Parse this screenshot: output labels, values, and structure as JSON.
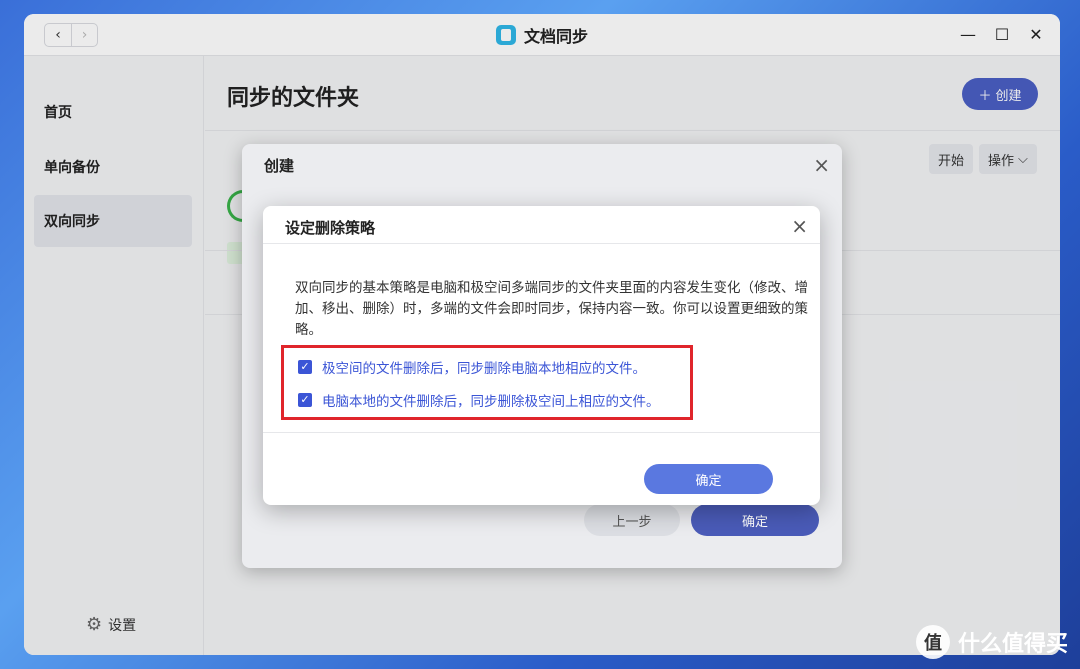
{
  "window": {
    "title": "文档同步",
    "nav_back": "‹",
    "nav_forward": "›",
    "ctrl_min": "—",
    "ctrl_max": "☐",
    "ctrl_close": "✕"
  },
  "sidebar": {
    "items": [
      {
        "label": "首页"
      },
      {
        "label": "单向备份"
      },
      {
        "label": "双向同步"
      }
    ],
    "settings_label": "设置"
  },
  "main": {
    "page_title": "同步的文件夹",
    "create_label": "创建",
    "start_label": "开始",
    "actions_label": "操作"
  },
  "create_dialog": {
    "title": "创建",
    "prev_label": "上一步",
    "ok_label": "确定"
  },
  "delete_dialog": {
    "title": "设定删除策略",
    "description": "双向同步的基本策略是电脑和极空间多端同步的文件夹里面的内容发生变化（修改、增加、移出、删除）时，多端的文件会即时同步，保持内容一致。你可以设置更细致的策略。",
    "options": [
      {
        "label": "极空间的文件删除后，同步删除电脑本地相应的文件。",
        "checked": true
      },
      {
        "label": "电脑本地的文件删除后，同步删除极空间上相应的文件。",
        "checked": true
      }
    ],
    "ok_label": "确定"
  },
  "watermark": {
    "logo": "值",
    "text": "什么值得买"
  }
}
